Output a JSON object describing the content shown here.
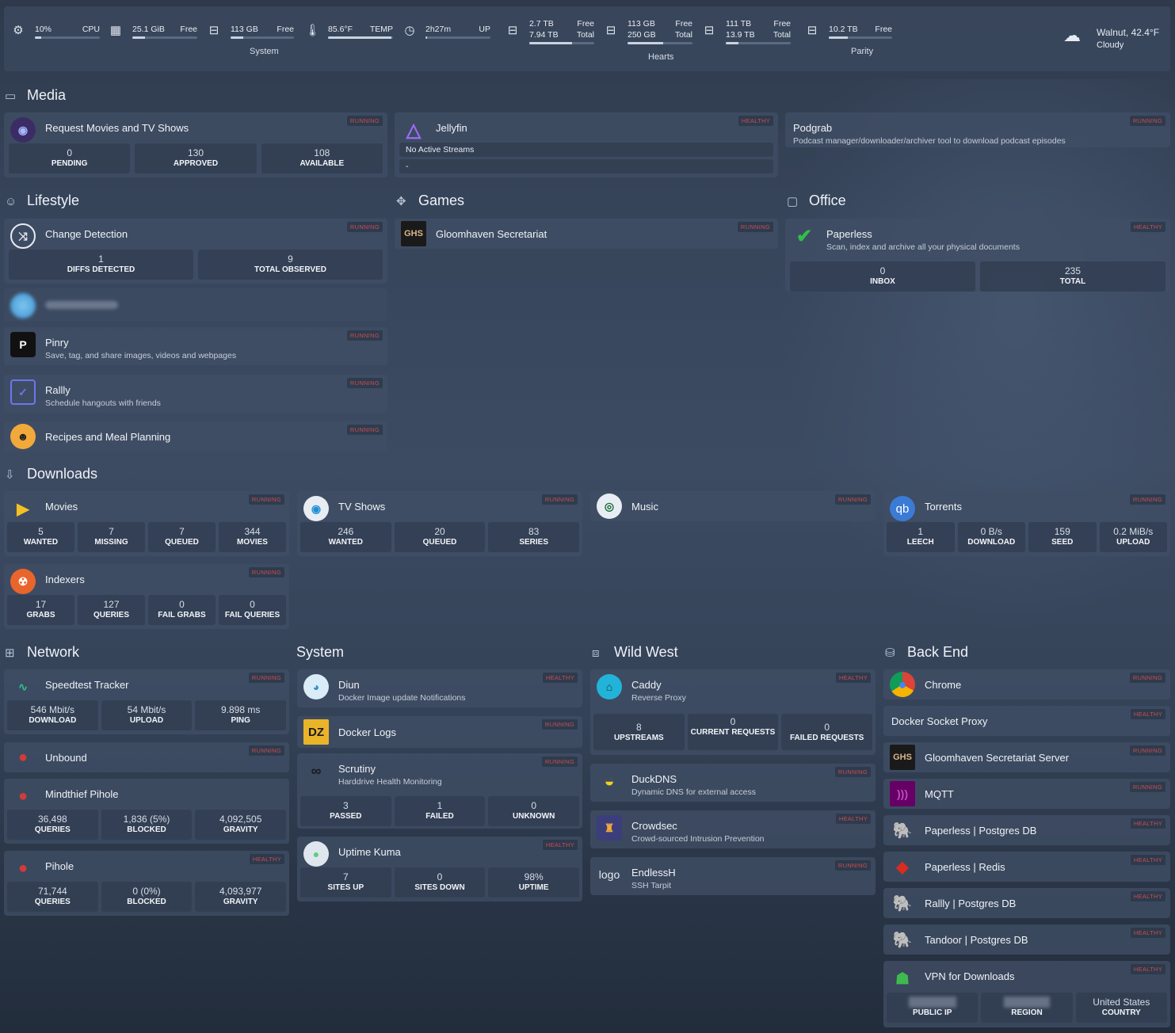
{
  "topbar": {
    "cpu": {
      "value": "10%",
      "label": "CPU",
      "fill": 0.1
    },
    "ram": {
      "value": "25.1 GiB",
      "label": "Free",
      "fill": 0.2
    },
    "disk_sys": {
      "value": "113 GB",
      "label": "Free",
      "fill": 0.2
    },
    "temp": {
      "value": "85.6°F",
      "label": "TEMP",
      "fill": 0.98
    },
    "uptime": {
      "value": "2h27m",
      "label": "UP",
      "fill": 0.02
    },
    "system_label": "System",
    "hearts": [
      {
        "v1": "2.7 TB",
        "v2": "7.94 TB",
        "l1": "Free",
        "l2": "Total",
        "fill": 0.66
      },
      {
        "v1": "113 GB",
        "v2": "250 GB",
        "l1": "Free",
        "l2": "Total",
        "fill": 0.55
      },
      {
        "v1": "111 TB",
        "v2": "13.9 TB",
        "l1": "Free",
        "l2": "Total",
        "fill": 0.2
      }
    ],
    "hearts_label": "Hearts",
    "parity": {
      "value": "10.2 TB",
      "label": "Free",
      "fill": 0.3
    },
    "parity_label": "Parity",
    "weather": {
      "location": "Walnut, 42.4°F",
      "desc": "Cloudy"
    }
  },
  "sections": {
    "media": "Media",
    "lifestyle": "Lifestyle",
    "games": "Games",
    "office": "Office",
    "downloads": "Downloads",
    "network": "Network",
    "system": "System",
    "wildwest": "Wild West",
    "backend": "Back End"
  },
  "badges": {
    "running": "RUNNING",
    "healthy": "HEALTHY"
  },
  "media": {
    "request": {
      "title": "Request Movies and TV Shows",
      "stats": [
        {
          "v": "0",
          "k": "PENDING"
        },
        {
          "v": "130",
          "k": "APPROVED"
        },
        {
          "v": "108",
          "k": "AVAILABLE"
        }
      ]
    },
    "jellyfin": {
      "title": "Jellyfin",
      "line1": "No Active Streams",
      "line2": "-"
    },
    "podgrab": {
      "title": "Podgrab",
      "desc": "Podcast manager/downloader/archiver tool to download podcast episodes"
    }
  },
  "lifestyle": {
    "change": {
      "title": "Change Detection",
      "stats": [
        {
          "v": "1",
          "k": "DIFFS DETECTED"
        },
        {
          "v": "9",
          "k": "TOTAL OBSERVED"
        }
      ]
    },
    "pinry": {
      "title": "Pinry",
      "desc": "Save, tag, and share images, videos and webpages"
    },
    "rallly": {
      "title": "Rallly",
      "desc": "Schedule hangouts with friends"
    },
    "recipes": {
      "title": "Recipes and Meal Planning"
    }
  },
  "games": {
    "gloom": {
      "title": "Gloomhaven Secretariat",
      "logo": "GHS"
    }
  },
  "office": {
    "paperless": {
      "title": "Paperless",
      "desc": "Scan, index and archive all your physical documents",
      "stats": [
        {
          "v": "0",
          "k": "INBOX"
        },
        {
          "v": "235",
          "k": "TOTAL"
        }
      ]
    }
  },
  "downloads": {
    "movies": {
      "title": "Movies",
      "stats": [
        {
          "v": "5",
          "k": "WANTED"
        },
        {
          "v": "7",
          "k": "MISSING"
        },
        {
          "v": "7",
          "k": "QUEUED"
        },
        {
          "v": "344",
          "k": "MOVIES"
        }
      ]
    },
    "tv": {
      "title": "TV Shows",
      "stats": [
        {
          "v": "246",
          "k": "WANTED"
        },
        {
          "v": "20",
          "k": "QUEUED"
        },
        {
          "v": "83",
          "k": "SERIES"
        }
      ]
    },
    "music": {
      "title": "Music"
    },
    "torrents": {
      "title": "Torrents",
      "logo": "qb",
      "stats": [
        {
          "v": "1",
          "k": "LEECH"
        },
        {
          "v": "0 B/s",
          "k": "DOWNLOAD"
        },
        {
          "v": "159",
          "k": "SEED"
        },
        {
          "v": "0.2 MiB/s",
          "k": "UPLOAD"
        }
      ]
    },
    "indexers": {
      "title": "Indexers",
      "stats": [
        {
          "v": "17",
          "k": "GRABS"
        },
        {
          "v": "127",
          "k": "QUERIES"
        },
        {
          "v": "0",
          "k": "FAIL GRABS"
        },
        {
          "v": "0",
          "k": "FAIL QUERIES"
        }
      ]
    }
  },
  "network": {
    "speedtest": {
      "title": "Speedtest Tracker",
      "stats": [
        {
          "v": "546 Mbit/s",
          "k": "DOWNLOAD"
        },
        {
          "v": "54 Mbit/s",
          "k": "UPLOAD"
        },
        {
          "v": "9.898 ms",
          "k": "PING"
        }
      ]
    },
    "unbound": {
      "title": "Unbound"
    },
    "mindthief": {
      "title": "Mindthief Pihole",
      "stats": [
        {
          "v": "36,498",
          "k": "QUERIES"
        },
        {
          "v": "1,836 (5%)",
          "k": "BLOCKED"
        },
        {
          "v": "4,092,505",
          "k": "GRAVITY"
        }
      ]
    },
    "pihole": {
      "title": "Pihole",
      "stats": [
        {
          "v": "71,744",
          "k": "QUERIES"
        },
        {
          "v": "0 (0%)",
          "k": "BLOCKED"
        },
        {
          "v": "4,093,977",
          "k": "GRAVITY"
        }
      ]
    }
  },
  "system": {
    "diun": {
      "title": "Diun",
      "desc": "Docker Image update Notifications"
    },
    "dockerlogs": {
      "title": "Docker Logs",
      "logo": "DZ"
    },
    "scrutiny": {
      "title": "Scrutiny",
      "desc": "Harddrive Health Monitoring",
      "stats": [
        {
          "v": "3",
          "k": "PASSED"
        },
        {
          "v": "1",
          "k": "FAILED"
        },
        {
          "v": "0",
          "k": "UNKNOWN"
        }
      ]
    },
    "kuma": {
      "title": "Uptime Kuma",
      "stats": [
        {
          "v": "7",
          "k": "SITES UP"
        },
        {
          "v": "0",
          "k": "SITES DOWN"
        },
        {
          "v": "98%",
          "k": "UPTIME"
        }
      ]
    }
  },
  "wildwest": {
    "caddy": {
      "title": "Caddy",
      "desc": "Reverse Proxy",
      "stats": [
        {
          "v": "8",
          "k": "UPSTREAMS"
        },
        {
          "v": "0",
          "k": "CURRENT REQUESTS"
        },
        {
          "v": "0",
          "k": "FAILED REQUESTS"
        }
      ]
    },
    "duckdns": {
      "title": "DuckDNS",
      "desc": "Dynamic DNS for external access"
    },
    "crowdsec": {
      "title": "Crowdsec",
      "desc": "Crowd-sourced Intrusion Prevention"
    },
    "endlessh": {
      "title": "EndlessH",
      "desc": "SSH Tarpit",
      "logo": "logo"
    }
  },
  "backend": {
    "chrome": {
      "title": "Chrome"
    },
    "dockerproxy": {
      "title": "Docker Socket Proxy"
    },
    "ghsserver": {
      "title": "Gloomhaven Secretariat Server",
      "logo": "GHS"
    },
    "mqtt": {
      "title": "MQTT"
    },
    "paperlessdb": {
      "title": "Paperless | Postgres DB"
    },
    "paperlessredis": {
      "title": "Paperless | Redis"
    },
    "ralllydb": {
      "title": "Rallly | Postgres DB"
    },
    "tandoordb": {
      "title": "Tandoor | Postgres DB"
    },
    "vpn": {
      "title": "VPN for Downloads",
      "stats": [
        {
          "v": "",
          "k": "PUBLIC IP"
        },
        {
          "v": "",
          "k": "REGION"
        },
        {
          "v": "United States",
          "k": "COUNTRY"
        }
      ]
    }
  },
  "colors": {
    "accent_red": "#c94d4d",
    "card_bg": "#404e65"
  }
}
